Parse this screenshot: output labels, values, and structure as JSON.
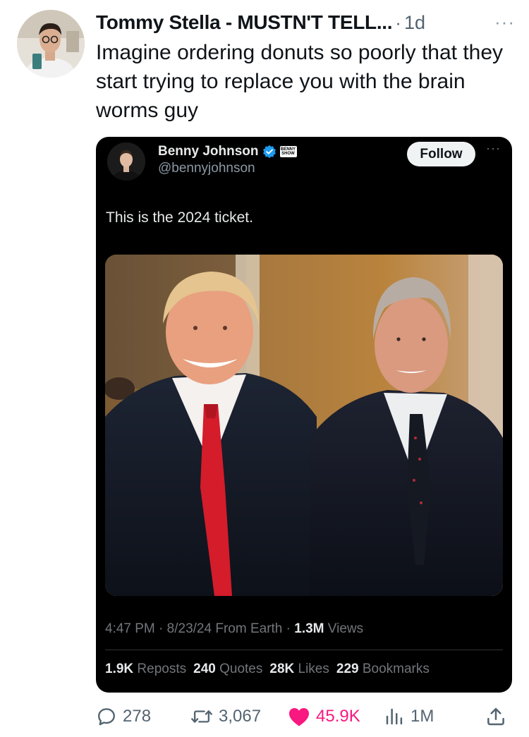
{
  "tweet": {
    "author_name": "Tommy Stella - MUSTN'T TELL...",
    "separator": "·",
    "age": "1d",
    "more": "···",
    "text": "Imagine ordering donuts so poorly that they start trying to replace you with the brain worms guy"
  },
  "quote": {
    "author_name": "Benny Johnson",
    "affiliate_badge": "BENNY SHOW",
    "handle": "@bennyjohnson",
    "follow_label": "Follow",
    "more": "···",
    "text": "This is the 2024 ticket.",
    "time": "4:47 PM",
    "date": "8/23/24",
    "source": "From Earth",
    "views_count": "1.3M",
    "views_label": "Views",
    "meta_sep": "·",
    "stats": [
      {
        "count": "1.9K",
        "label": "Reposts"
      },
      {
        "count": "240",
        "label": "Quotes"
      },
      {
        "count": "28K",
        "label": "Likes"
      },
      {
        "count": "229",
        "label": "Bookmarks"
      }
    ]
  },
  "actions": {
    "replies": "278",
    "reposts": "3,067",
    "likes": "45.9K",
    "views": "1M"
  },
  "colors": {
    "like_pink": "#f91880",
    "verified_blue": "#1d9bf0",
    "muted": "#536471"
  }
}
